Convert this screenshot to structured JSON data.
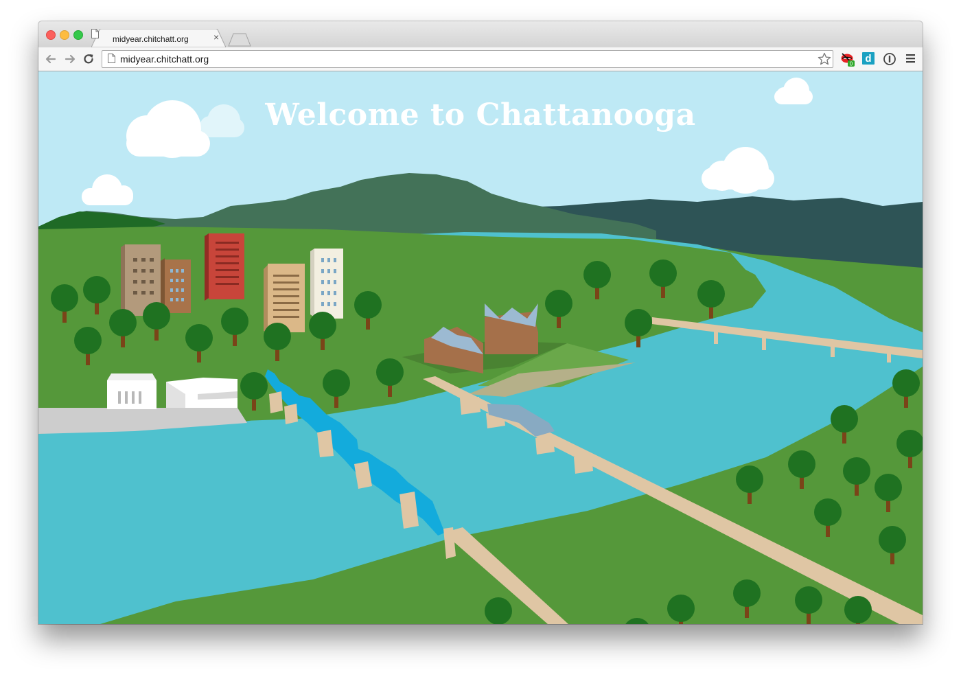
{
  "browser": {
    "tab": {
      "title": "midyear.chitchatt.org",
      "close_glyph": "×"
    },
    "address_bar": {
      "url": "midyear.chitchatt.org"
    },
    "extensions": [
      {
        "name": "lips-icon",
        "badge": "0"
      },
      {
        "name": "d-icon",
        "label": "d"
      },
      {
        "name": "onepassword-icon"
      }
    ]
  },
  "page": {
    "headline": "Welcome to Chattanooga"
  },
  "colors": {
    "sky": "#bee9f5",
    "grass": "#55983a",
    "river": "#4fc1ce",
    "mountain": "#437258",
    "dark_mountain": "#2e5456",
    "tree": "#1f7221",
    "trunk": "#7a4418",
    "bridge": "#dfc6a4",
    "blue_bridge": "#13abdc"
  }
}
